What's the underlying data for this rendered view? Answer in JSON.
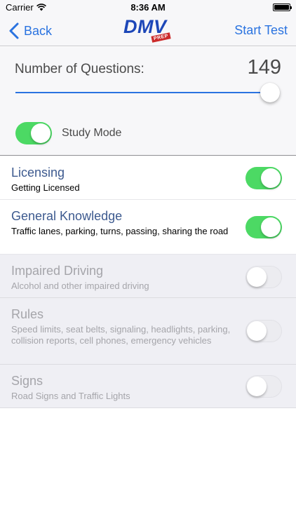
{
  "status_bar": {
    "carrier": "Carrier",
    "time": "8:36 AM"
  },
  "nav": {
    "back_label": "Back",
    "logo_text": "DMV",
    "logo_badge": "PREP",
    "start_label": "Start Test"
  },
  "settings": {
    "questions_label": "Number of Questions:",
    "questions_value": "149",
    "slider_level": 1.0,
    "study_mode_label": "Study Mode",
    "study_mode_on": true
  },
  "categories": [
    {
      "title": "Licensing",
      "subtitle": "Getting Licensed",
      "enabled": true,
      "on": true
    },
    {
      "title": "General Knowledge",
      "subtitle": "Traffic lanes, parking, turns, passing, sharing the road",
      "enabled": true,
      "on": true
    },
    {
      "title": "Impaired Driving",
      "subtitle": "Alcohol and other impaired driving",
      "enabled": false,
      "on": false
    },
    {
      "title": "Rules",
      "subtitle": "Speed limits, seat belts, signaling, headlights, parking, collision reports, cell phones, emergency vehicles",
      "enabled": false,
      "on": false
    },
    {
      "title": "Signs",
      "subtitle": "Road Signs and Traffic Lights",
      "enabled": false,
      "on": false
    }
  ],
  "colors": {
    "accent": "#2a73e0",
    "toggle_on": "#4cd964",
    "title_blue": "#3d5a8f",
    "disabled_bg": "#efeff4"
  }
}
